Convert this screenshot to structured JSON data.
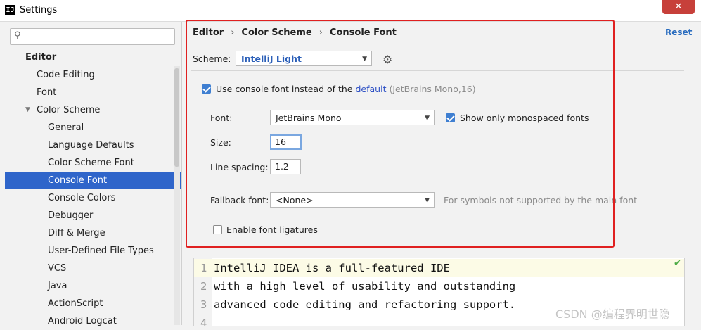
{
  "window": {
    "title": "Settings",
    "app_icon": "IJ",
    "close": "✕"
  },
  "sidebar": {
    "search": {
      "placeholder": "",
      "value": ""
    },
    "items": [
      {
        "label": "Editor",
        "level": 0
      },
      {
        "label": "Code Editing",
        "level": 1
      },
      {
        "label": "Font",
        "level": 1
      },
      {
        "label": "Color Scheme",
        "level": 1,
        "expanded": true
      },
      {
        "label": "General",
        "level": 2
      },
      {
        "label": "Language Defaults",
        "level": 2
      },
      {
        "label": "Color Scheme Font",
        "level": 2
      },
      {
        "label": "Console Font",
        "level": 2,
        "selected": true
      },
      {
        "label": "Console Colors",
        "level": 2
      },
      {
        "label": "Debugger",
        "level": 2
      },
      {
        "label": "Diff & Merge",
        "level": 2
      },
      {
        "label": "User-Defined File Types",
        "level": 2
      },
      {
        "label": "VCS",
        "level": 2
      },
      {
        "label": "Java",
        "level": 2
      },
      {
        "label": "ActionScript",
        "level": 2
      },
      {
        "label": "Android Logcat",
        "level": 2
      }
    ]
  },
  "main": {
    "breadcrumb": [
      "Editor",
      "Color Scheme",
      "Console Font"
    ],
    "reset_label": "Reset",
    "scheme": {
      "label": "Scheme:",
      "value": "IntelliJ Light"
    },
    "use_console_font": {
      "checked": true,
      "text": "Use console font instead of the",
      "link": "default",
      "detail": "(JetBrains Mono,16)"
    },
    "font": {
      "label": "Font:",
      "value": "JetBrains Mono"
    },
    "monospaced_only": {
      "checked": true,
      "label": "Show only monospaced fonts"
    },
    "size": {
      "label": "Size:",
      "value": "16"
    },
    "line_spacing": {
      "label": "Line spacing:",
      "value": "1.2"
    },
    "fallback": {
      "label": "Fallback font:",
      "value": "<None>",
      "hint": "For symbols not supported by the main font"
    },
    "ligatures": {
      "checked": false,
      "label": "Enable font ligatures"
    }
  },
  "preview": {
    "lines": [
      {
        "num": "1",
        "text": "IntelliJ IDEA is a full-featured IDE"
      },
      {
        "num": "2",
        "text": "with a high level of usability and outstanding"
      },
      {
        "num": "3",
        "text": "advanced code editing and refactoring support."
      },
      {
        "num": "4",
        "text": ""
      }
    ],
    "status_icon": "✔"
  },
  "watermark": "CSDN @编程界明世隐",
  "colors": {
    "accent": "#2f65ca",
    "highlight_border": "#e02020",
    "link": "#2b4ec4"
  }
}
